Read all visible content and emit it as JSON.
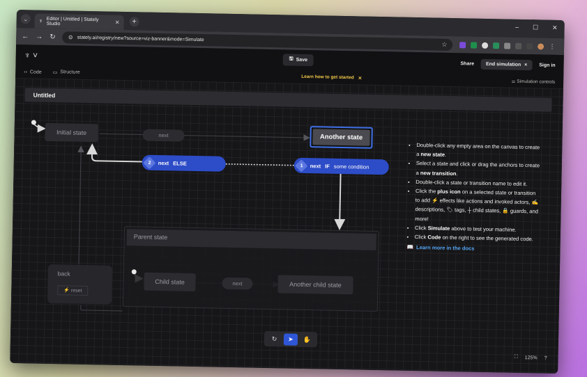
{
  "browser": {
    "tab_title": "Editor | Untitled | Stately Studio",
    "url": "stately.ai/registry/new?source=viz-banner&mode=Simulate",
    "window_controls": [
      "–",
      "☐",
      "✕"
    ]
  },
  "app": {
    "save_label": "Save",
    "share_label": "Share",
    "end_simulation_label": "End simulation",
    "sign_in_label": "Sign in",
    "code_tab": "Code",
    "structure_tab": "Structure",
    "learn_banner": "Learn how to get started",
    "simulation_controls": "Simulation controls",
    "accent_color": "#2d4cc7"
  },
  "canvas": {
    "machine_title": "Untitled",
    "states": {
      "initial": "Initial state",
      "another": "Another state",
      "parent": "Parent state",
      "child": "Child state",
      "another_child": "Another child state",
      "back": "back"
    },
    "events": {
      "next_top": "next",
      "next_child": "next",
      "reset": "reset"
    },
    "transitions": {
      "else": {
        "num": "2",
        "event": "next",
        "guard": "ELSE"
      },
      "if": {
        "num": "1",
        "event": "next",
        "guard": "IF",
        "condition": "some condition"
      }
    }
  },
  "help": {
    "items": [
      {
        "pre": "Double-click any empty area on the canvas to create a ",
        "bold": "new state",
        "post": "."
      },
      {
        "pre": "Select a state and click or drag the anchors to create a ",
        "bold": "new transition",
        "post": "."
      },
      {
        "pre": "Double-click a state or transition name to edit it.",
        "bold": "",
        "post": ""
      },
      {
        "pre": "Click the ",
        "bold": "plus icon",
        "post": " on a selected state or transition to add ⚡ effects like actions and invoked actors, ✍ descriptions, 🏷 tags, ┼ child states, 🔒 guards, and more!"
      },
      {
        "pre": "Click ",
        "bold": "Simulate",
        "post": " above to test your machine."
      },
      {
        "pre": "Click ",
        "bold": "Code",
        "post": " on the right to see the generated code."
      }
    ],
    "docs_link": "Learn more in the docs"
  },
  "footer": {
    "zoom": "125%"
  }
}
